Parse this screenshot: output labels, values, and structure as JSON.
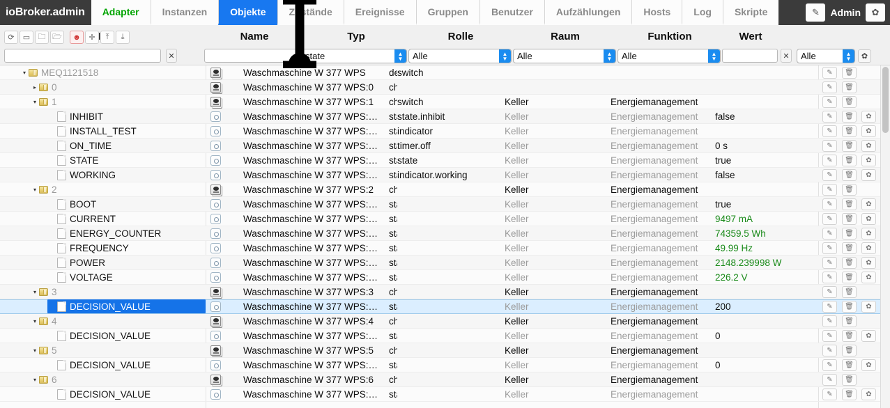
{
  "app": {
    "brand": "ioBroker.admin",
    "username": "Admin"
  },
  "tabs": [
    {
      "label": "Adapter",
      "state": "green"
    },
    {
      "label": "Instanzen",
      "state": "normal"
    },
    {
      "label": "Objekte",
      "state": "active"
    },
    {
      "label": "Zustände",
      "state": "normal"
    },
    {
      "label": "Ereignisse",
      "state": "normal"
    },
    {
      "label": "Gruppen",
      "state": "normal"
    },
    {
      "label": "Benutzer",
      "state": "normal"
    },
    {
      "label": "Aufzählungen",
      "state": "normal"
    },
    {
      "label": "Hosts",
      "state": "normal"
    },
    {
      "label": "Log",
      "state": "normal"
    },
    {
      "label": "Skripte",
      "state": "normal"
    }
  ],
  "user_actions": {
    "edit_icon": "pencil-icon",
    "settings_icon": "gear-icon"
  },
  "columns": [
    {
      "key": "id",
      "label": "ID"
    },
    {
      "key": "name",
      "label": "Name"
    },
    {
      "key": "typ",
      "label": "Typ"
    },
    {
      "key": "rolle",
      "label": "Rolle"
    },
    {
      "key": "raum",
      "label": "Raum"
    },
    {
      "key": "funktion",
      "label": "Funktion"
    },
    {
      "key": "wert",
      "label": "Wert"
    }
  ],
  "toolbar": [
    {
      "name": "refresh-icon",
      "glyph": "⟳"
    },
    {
      "name": "collapse-all-icon",
      "glyph": "▭"
    },
    {
      "name": "expand-folder-icon",
      "glyph": "🗀"
    },
    {
      "name": "open-folder-icon",
      "glyph": "🗁"
    },
    {
      "name": "expert-mode-icon",
      "glyph": "☻",
      "highlight": true
    },
    {
      "name": "add-object-icon",
      "glyph": "✛"
    },
    {
      "name": "import-icon",
      "glyph": "⤒"
    },
    {
      "name": "export-icon",
      "glyph": "⤓"
    }
  ],
  "filters": {
    "id_value": "",
    "id_clear_label": "✕",
    "name_value": "",
    "typ_value": "state",
    "rolle_value": "Alle",
    "raum_value": "Alle",
    "funktion_value": "Alle",
    "wert_value": "",
    "wert_clear_label": "✕",
    "last_value": "Alle",
    "settings_icon": "gear-icon"
  },
  "tree": [
    {
      "indent": 0,
      "twig": "▾",
      "icon": "folder",
      "label": "MEQ1121518",
      "style": "folder",
      "selected": false
    },
    {
      "indent": 1,
      "twig": "▸",
      "icon": "folder",
      "label": "0",
      "style": "folder",
      "selected": false
    },
    {
      "indent": 1,
      "twig": "▾",
      "icon": "folder",
      "label": "1",
      "style": "folder",
      "selected": false
    },
    {
      "indent": 2,
      "twig": "",
      "icon": "doc",
      "label": "INHIBIT",
      "style": "leaf",
      "selected": false
    },
    {
      "indent": 2,
      "twig": "",
      "icon": "doc",
      "label": "INSTALL_TEST",
      "style": "leaf",
      "selected": false
    },
    {
      "indent": 2,
      "twig": "",
      "icon": "doc",
      "label": "ON_TIME",
      "style": "leaf",
      "selected": false
    },
    {
      "indent": 2,
      "twig": "",
      "icon": "doc",
      "label": "STATE",
      "style": "leaf",
      "selected": false
    },
    {
      "indent": 2,
      "twig": "",
      "icon": "doc",
      "label": "WORKING",
      "style": "leaf",
      "selected": false
    },
    {
      "indent": 1,
      "twig": "▾",
      "icon": "folder",
      "label": "2",
      "style": "folder",
      "selected": false
    },
    {
      "indent": 2,
      "twig": "",
      "icon": "doc",
      "label": "BOOT",
      "style": "leaf",
      "selected": false
    },
    {
      "indent": 2,
      "twig": "",
      "icon": "doc",
      "label": "CURRENT",
      "style": "leaf",
      "selected": false
    },
    {
      "indent": 2,
      "twig": "",
      "icon": "doc",
      "label": "ENERGY_COUNTER",
      "style": "leaf",
      "selected": false
    },
    {
      "indent": 2,
      "twig": "",
      "icon": "doc",
      "label": "FREQUENCY",
      "style": "leaf",
      "selected": false
    },
    {
      "indent": 2,
      "twig": "",
      "icon": "doc",
      "label": "POWER",
      "style": "leaf",
      "selected": false
    },
    {
      "indent": 2,
      "twig": "",
      "icon": "doc",
      "label": "VOLTAGE",
      "style": "leaf",
      "selected": false
    },
    {
      "indent": 1,
      "twig": "▾",
      "icon": "folder",
      "label": "3",
      "style": "folder",
      "selected": false
    },
    {
      "indent": 2,
      "twig": "",
      "icon": "doc",
      "label": "DECISION_VALUE",
      "style": "leaf",
      "selected": true
    },
    {
      "indent": 1,
      "twig": "▾",
      "icon": "folder",
      "label": "4",
      "style": "folder",
      "selected": false
    },
    {
      "indent": 2,
      "twig": "",
      "icon": "doc",
      "label": "DECISION_VALUE",
      "style": "leaf",
      "selected": false
    },
    {
      "indent": 1,
      "twig": "▾",
      "icon": "folder",
      "label": "5",
      "style": "folder",
      "selected": false
    },
    {
      "indent": 2,
      "twig": "",
      "icon": "doc",
      "label": "DECISION_VALUE",
      "style": "leaf",
      "selected": false
    },
    {
      "indent": 1,
      "twig": "▾",
      "icon": "folder",
      "label": "6",
      "style": "folder",
      "selected": false
    },
    {
      "indent": 2,
      "twig": "",
      "icon": "doc",
      "label": "DECISION_VALUE",
      "style": "leaf",
      "selected": false
    }
  ],
  "rows": [
    {
      "icon": "device",
      "name": "Waschmaschine W 377 WPS",
      "typ": "de",
      "rolle": "switch",
      "raum": "",
      "funktion": "",
      "wert": "",
      "dim": false,
      "green": false,
      "gear": false,
      "selected": false
    },
    {
      "icon": "device",
      "name": "Waschmaschine W 377 WPS:0",
      "typ": "ch",
      "rolle": "",
      "raum": "",
      "funktion": "",
      "wert": "",
      "dim": false,
      "green": false,
      "gear": false,
      "selected": false
    },
    {
      "icon": "device",
      "name": "Waschmaschine W 377 WPS:1",
      "typ": "ch",
      "rolle": "switch",
      "raum": "Keller",
      "funktion": "Energiemanagement",
      "wert": "",
      "dim": false,
      "green": false,
      "gear": false,
      "selected": false
    },
    {
      "icon": "state",
      "name": "Waschmaschine W 377 WPS:…",
      "typ": "sta",
      "rolle": "state.inhibit",
      "raum": "Keller",
      "funktion": "Energiemanagement",
      "wert": "false",
      "dim": true,
      "green": false,
      "gear": true,
      "selected": false
    },
    {
      "icon": "state",
      "name": "Waschmaschine W 377 WPS:…",
      "typ": "sta",
      "rolle": "indicator",
      "raum": "Keller",
      "funktion": "Energiemanagement",
      "wert": "",
      "dim": true,
      "green": false,
      "gear": true,
      "selected": false
    },
    {
      "icon": "state",
      "name": "Waschmaschine W 377 WPS:…",
      "typ": "sta",
      "rolle": "timer.off",
      "raum": "Keller",
      "funktion": "Energiemanagement",
      "wert": "0 s",
      "dim": true,
      "green": false,
      "gear": true,
      "selected": false
    },
    {
      "icon": "state",
      "name": "Waschmaschine W 377 WPS:…",
      "typ": "sta",
      "rolle": "state",
      "raum": "Keller",
      "funktion": "Energiemanagement",
      "wert": "true",
      "dim": true,
      "green": false,
      "gear": true,
      "selected": false
    },
    {
      "icon": "state",
      "name": "Waschmaschine W 377 WPS:…",
      "typ": "sta",
      "rolle": "indicator.working",
      "raum": "Keller",
      "funktion": "Energiemanagement",
      "wert": "false",
      "dim": true,
      "green": false,
      "gear": true,
      "selected": false
    },
    {
      "icon": "device",
      "name": "Waschmaschine W 377 WPS:2",
      "typ": "ch",
      "rolle": "",
      "raum": "Keller",
      "funktion": "Energiemanagement",
      "wert": "",
      "dim": false,
      "green": false,
      "gear": false,
      "selected": false
    },
    {
      "icon": "state",
      "name": "Waschmaschine W 377 WPS:…",
      "typ": "sta",
      "rolle": "",
      "raum": "Keller",
      "funktion": "Energiemanagement",
      "wert": "true",
      "dim": true,
      "green": false,
      "gear": true,
      "selected": false
    },
    {
      "icon": "state",
      "name": "Waschmaschine W 377 WPS:…",
      "typ": "sta",
      "rolle": "",
      "raum": "Keller",
      "funktion": "Energiemanagement",
      "wert": "9497 mA",
      "dim": true,
      "green": true,
      "gear": true,
      "selected": false
    },
    {
      "icon": "state",
      "name": "Waschmaschine W 377 WPS:…",
      "typ": "sta",
      "rolle": "",
      "raum": "Keller",
      "funktion": "Energiemanagement",
      "wert": "74359.5 Wh",
      "dim": true,
      "green": true,
      "gear": true,
      "selected": false
    },
    {
      "icon": "state",
      "name": "Waschmaschine W 377 WPS:…",
      "typ": "sta",
      "rolle": "",
      "raum": "Keller",
      "funktion": "Energiemanagement",
      "wert": "49.99 Hz",
      "dim": true,
      "green": true,
      "gear": true,
      "selected": false
    },
    {
      "icon": "state",
      "name": "Waschmaschine W 377 WPS:…",
      "typ": "sta",
      "rolle": "",
      "raum": "Keller",
      "funktion": "Energiemanagement",
      "wert": "2148.239998 W",
      "dim": true,
      "green": true,
      "gear": true,
      "selected": false
    },
    {
      "icon": "state",
      "name": "Waschmaschine W 377 WPS:…",
      "typ": "sta",
      "rolle": "",
      "raum": "Keller",
      "funktion": "Energiemanagement",
      "wert": "226.2 V",
      "dim": true,
      "green": true,
      "gear": true,
      "selected": false
    },
    {
      "icon": "device",
      "name": "Waschmaschine W 377 WPS:3",
      "typ": "ch",
      "rolle": "",
      "raum": "Keller",
      "funktion": "Energiemanagement",
      "wert": "",
      "dim": false,
      "green": false,
      "gear": false,
      "selected": false
    },
    {
      "icon": "state",
      "name": "Waschmaschine W 377 WPS:…",
      "typ": "sta",
      "rolle": "",
      "raum": "Keller",
      "funktion": "Energiemanagement",
      "wert": "200",
      "dim": true,
      "green": false,
      "gear": true,
      "selected": true
    },
    {
      "icon": "device",
      "name": "Waschmaschine W 377 WPS:4",
      "typ": "ch",
      "rolle": "",
      "raum": "Keller",
      "funktion": "Energiemanagement",
      "wert": "",
      "dim": false,
      "green": false,
      "gear": false,
      "selected": false
    },
    {
      "icon": "state",
      "name": "Waschmaschine W 377 WPS:…",
      "typ": "sta",
      "rolle": "",
      "raum": "Keller",
      "funktion": "Energiemanagement",
      "wert": "0",
      "dim": true,
      "green": false,
      "gear": true,
      "selected": false
    },
    {
      "icon": "device",
      "name": "Waschmaschine W 377 WPS:5",
      "typ": "ch",
      "rolle": "",
      "raum": "Keller",
      "funktion": "Energiemanagement",
      "wert": "",
      "dim": false,
      "green": false,
      "gear": false,
      "selected": false
    },
    {
      "icon": "state",
      "name": "Waschmaschine W 377 WPS:…",
      "typ": "sta",
      "rolle": "",
      "raum": "Keller",
      "funktion": "Energiemanagement",
      "wert": "0",
      "dim": true,
      "green": false,
      "gear": true,
      "selected": false
    },
    {
      "icon": "device",
      "name": "Waschmaschine W 377 WPS:6",
      "typ": "ch",
      "rolle": "",
      "raum": "Keller",
      "funktion": "Energiemanagement",
      "wert": "",
      "dim": false,
      "green": false,
      "gear": false,
      "selected": false
    },
    {
      "icon": "state",
      "name": "Waschmaschine W 377 WPS:…",
      "typ": "sta",
      "rolle": "",
      "raum": "Keller",
      "funktion": "Energiemanagement",
      "wert": "",
      "dim": true,
      "green": false,
      "gear": true,
      "selected": false
    }
  ],
  "row_actions": {
    "edit_icon": "pencil-icon",
    "delete_icon": "trash-icon",
    "settings_icon": "gear-icon"
  },
  "colors": {
    "accent": "#1878f0",
    "adapter_green": "#00a400",
    "value_green": "#198a19",
    "selection": "#1573e8",
    "header_dark": "#3b3b3b"
  }
}
